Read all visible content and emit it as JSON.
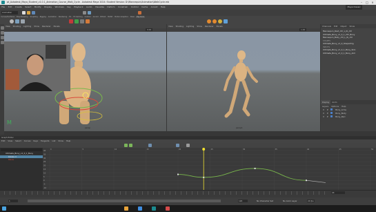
{
  "window": {
    "title": "pt_Autodesk_Maya_Student_v1.0.1_Animation_Course_Walk_Cycle - Autodesk Maya 2024: Student Version: D:\\Mannequin\\Animation\\WalkCycle.mb",
    "shelf_menu": "Animation",
    "workspace": "Maya Classic"
  },
  "menus": [
    "File",
    "Edit",
    "Create",
    "Select",
    "Modify",
    "Display",
    "Windows",
    "Key",
    "Playback",
    "Audio",
    "Visualize",
    "Deform",
    "Constrain",
    "Control",
    "Cache",
    "Arnold",
    "Help"
  ],
  "shelf_tabs": [
    "Curves/Surfaces",
    "Poly Modeling",
    "Sculpting",
    "Rigging",
    "Animation",
    "Rendering",
    "FX",
    "FX Caching",
    "Custom",
    "Arnold",
    "Bifrost",
    "MASH",
    "Motion Graphics",
    "XGen",
    "Big Tools"
  ],
  "viewport_left": {
    "menus": [
      "View",
      "Shading",
      "Lighting",
      "Show",
      "Renderer",
      "Panels"
    ],
    "camera": "persp",
    "field": "0.00"
  },
  "viewport_right": {
    "menus": [
      "View",
      "Shading",
      "Lighting",
      "Show",
      "Renderer",
      "Panels"
    ],
    "camera": "persp1",
    "field": "1.00"
  },
  "channel_box": {
    "tabs": [
      "Channels",
      "Edit",
      "Object",
      "Show"
    ],
    "items": [
      "Mannequin_Root_ctrl_L_IK_ctrl",
      "Ultimate_Bony_v1_0_1_Ctrl_Bony",
      "Mannequin_Body_ctrl_L_IK_ctrl",
      "SHAPES",
      "Ultimate_Bony_v1_0_ShapeOrig",
      "INPUTS",
      "Ultimate_Bony_v1_0_1_Bony_Skin",
      "Ultimate_Bony_v1_0_1_Bony_Arm"
    ]
  },
  "layer_editor": {
    "tabs": [
      "Display",
      "Anim"
    ],
    "menus": [
      "Layers",
      "Options",
      "Help"
    ],
    "layers": [
      {
        "v": "V",
        "p": "P",
        "name": "Bony_Arms"
      },
      {
        "v": "V",
        "p": "P",
        "name": "Bony_Body"
      },
      {
        "v": "V",
        "p": "P",
        "name": "Bony_Rsrc"
      }
    ]
  },
  "graph_editor": {
    "title": "Graph Editor",
    "menus": [
      "Edit",
      "View",
      "Select",
      "Curves",
      "Keys",
      "Tangents",
      "List",
      "Show",
      "Help"
    ],
    "outliner": [
      {
        "label": "Ultimate_Bony_v1_0_1_Bony",
        "indent": 0
      },
      {
        "label": "Rotate X",
        "indent": 1,
        "selected": true
      },
      {
        "label": "Pelvis",
        "indent": 1
      }
    ],
    "y_ticks": [
      "40",
      "35",
      "30",
      "25",
      "20",
      "15",
      "10",
      "5",
      "0",
      "-5",
      "-10"
    ],
    "x_ticks": [
      "0",
      "5",
      "10",
      "15",
      "20",
      "25",
      "30",
      "35",
      "40",
      "45",
      "50"
    ],
    "curve_keys": [
      {
        "frame": 20,
        "value": 8
      },
      {
        "frame": 24,
        "value": 4
      },
      {
        "frame": 32,
        "value": 16
      },
      {
        "frame": 40,
        "value": 0
      }
    ],
    "current_frame": "24"
  },
  "timeline": {
    "start": "1",
    "end": "120",
    "fps": "24 fps",
    "character": "No Character Set",
    "anim_layer": "No Anim Layer"
  },
  "colors": {
    "curve_color": "#7ab84c",
    "playhead": "#f0e030",
    "accent": "#5285a6"
  }
}
